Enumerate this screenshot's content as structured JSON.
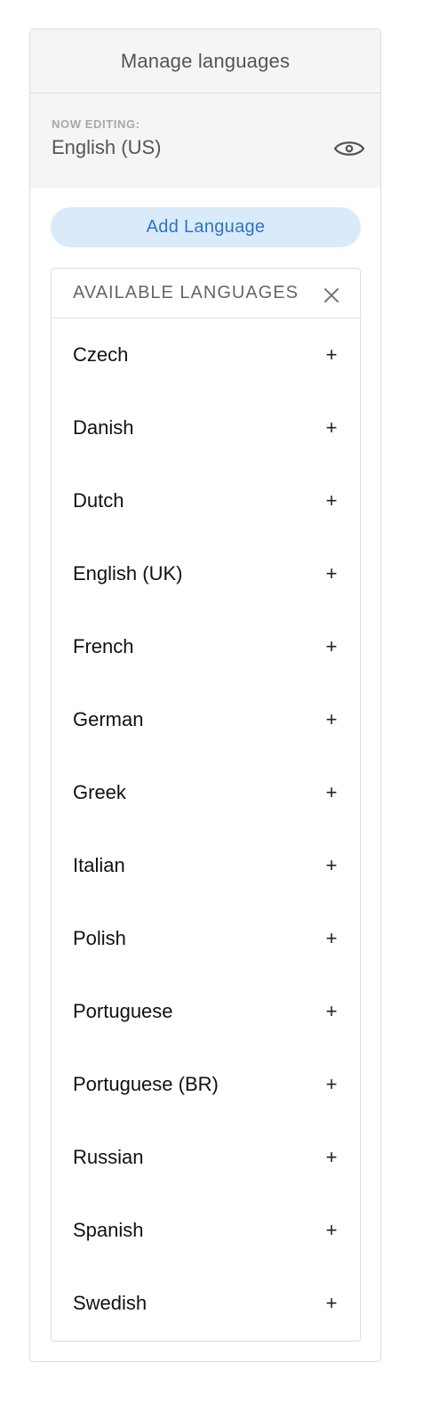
{
  "header": {
    "title": "Manage languages"
  },
  "editing": {
    "label": "NOW EDITING:",
    "value": "English (US)",
    "preview_icon": "eye-icon"
  },
  "add_button": {
    "label": "Add Language"
  },
  "available": {
    "title": "AVAILABLE LANGUAGES",
    "close_icon": "close-icon",
    "add_icon_glyph": "+",
    "items": [
      {
        "label": "Czech"
      },
      {
        "label": "Danish"
      },
      {
        "label": "Dutch"
      },
      {
        "label": "English (UK)"
      },
      {
        "label": "French"
      },
      {
        "label": "German"
      },
      {
        "label": "Greek"
      },
      {
        "label": "Italian"
      },
      {
        "label": "Polish"
      },
      {
        "label": "Portuguese"
      },
      {
        "label": "Portuguese (BR)"
      },
      {
        "label": "Russian"
      },
      {
        "label": "Spanish"
      },
      {
        "label": "Swedish"
      }
    ]
  },
  "colors": {
    "accent": "#2f74c4",
    "accent_bg": "#d9ebfb",
    "panel_bg": "#f5f5f5"
  }
}
